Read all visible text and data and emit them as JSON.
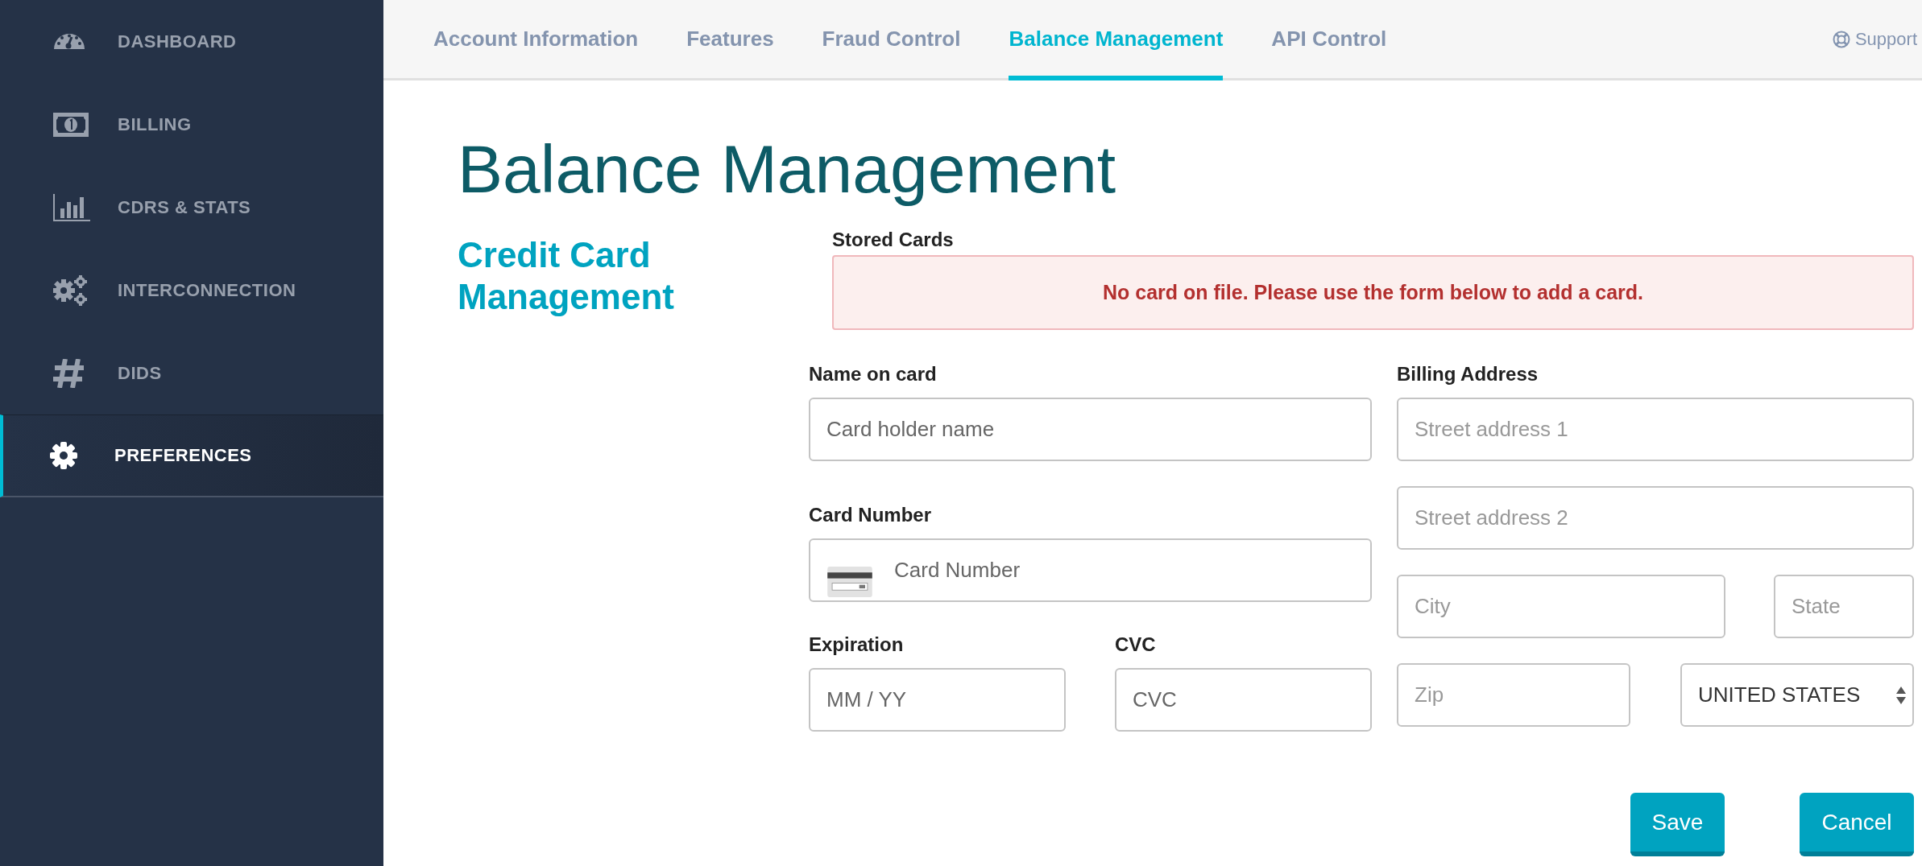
{
  "sidebar": {
    "items": [
      {
        "label": "DASHBOARD",
        "selected": false
      },
      {
        "label": "BILLING",
        "selected": false
      },
      {
        "label": "CDRS & STATS",
        "selected": false
      },
      {
        "label": "INTERCONNECTION",
        "selected": false
      },
      {
        "label": "DIDS",
        "selected": false
      },
      {
        "label": "PREFERENCES",
        "selected": true
      }
    ]
  },
  "tabs": [
    {
      "label": "Account Information",
      "selected": false
    },
    {
      "label": "Features",
      "selected": false
    },
    {
      "label": "Fraud Control",
      "selected": false
    },
    {
      "label": "Balance Management",
      "selected": true
    },
    {
      "label": "API Control",
      "selected": false
    }
  ],
  "support": "Support",
  "page_title": "Balance Management",
  "section_title": "Credit Card Management",
  "stored_cards": {
    "label": "Stored Cards",
    "message": "No card on file. Please use the form below to add a card."
  },
  "name_on_card": {
    "label": "Name on card",
    "placeholder": "Card holder name"
  },
  "card_number": {
    "label": "Card Number",
    "placeholder": "Card Number"
  },
  "expiration": {
    "label": "Expiration",
    "placeholder": "MM / YY"
  },
  "cvc": {
    "label": "CVC",
    "placeholder": "CVC"
  },
  "billing_address": {
    "label": "Billing Address",
    "street_1": {
      "placeholder": "Street address 1"
    },
    "street_2": {
      "placeholder": "Street address 2"
    },
    "city": {
      "placeholder": "City"
    },
    "state": {
      "placeholder": "State"
    },
    "zip": {
      "placeholder": "Zip"
    },
    "country": {
      "value": "UNITED STATES"
    }
  },
  "buttons": [
    "Save",
    "Cancel"
  ]
}
